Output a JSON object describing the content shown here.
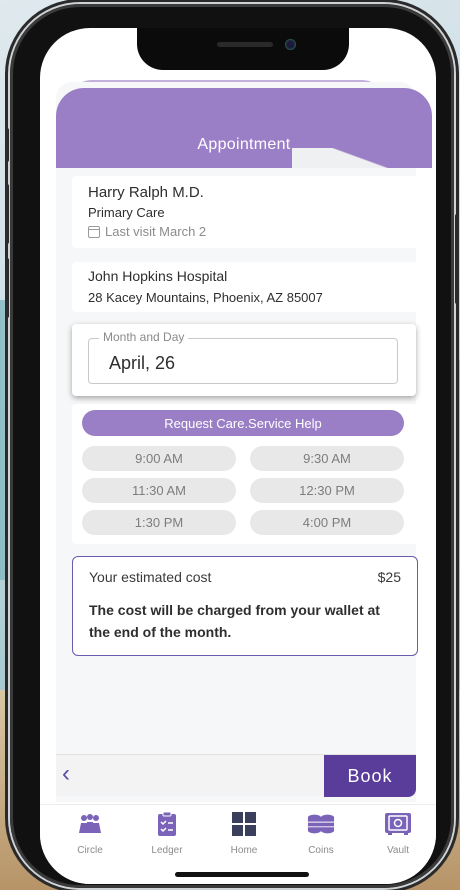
{
  "header": {
    "title": "Appointment"
  },
  "doctor": {
    "name": "Harry Ralph M.D.",
    "specialty": "Primary Care",
    "last_visit": "Last visit March 2"
  },
  "hospital": {
    "name": "John Hopkins Hospital",
    "address": "28 Kacey Mountains, Phoenix, AZ 85007"
  },
  "date_field": {
    "label": "Month and Day",
    "value": "April, 26"
  },
  "help_button": "Request Care.Service Help",
  "time_slots": [
    "9:00 AM",
    "9:30 AM",
    "11:30 AM",
    "12:30 PM",
    "1:30 PM",
    "4:00 PM"
  ],
  "cost": {
    "label": "Your estimated cost",
    "amount": "$25",
    "note": "The cost will be charged from your wallet at the end of the month."
  },
  "actions": {
    "back": "‹",
    "book": "Book"
  },
  "tabs": [
    {
      "label": "Circle",
      "icon": "people-icon"
    },
    {
      "label": "Ledger",
      "icon": "clipboard-icon"
    },
    {
      "label": "Home",
      "icon": "grid-icon"
    },
    {
      "label": "Coins",
      "icon": "coins-icon"
    },
    {
      "label": "Vault",
      "icon": "vault-icon"
    }
  ],
  "colors": {
    "accent": "#9b7fc6",
    "primary_dark": "#5a3d9a",
    "tab_icon": "#7a63b8"
  }
}
